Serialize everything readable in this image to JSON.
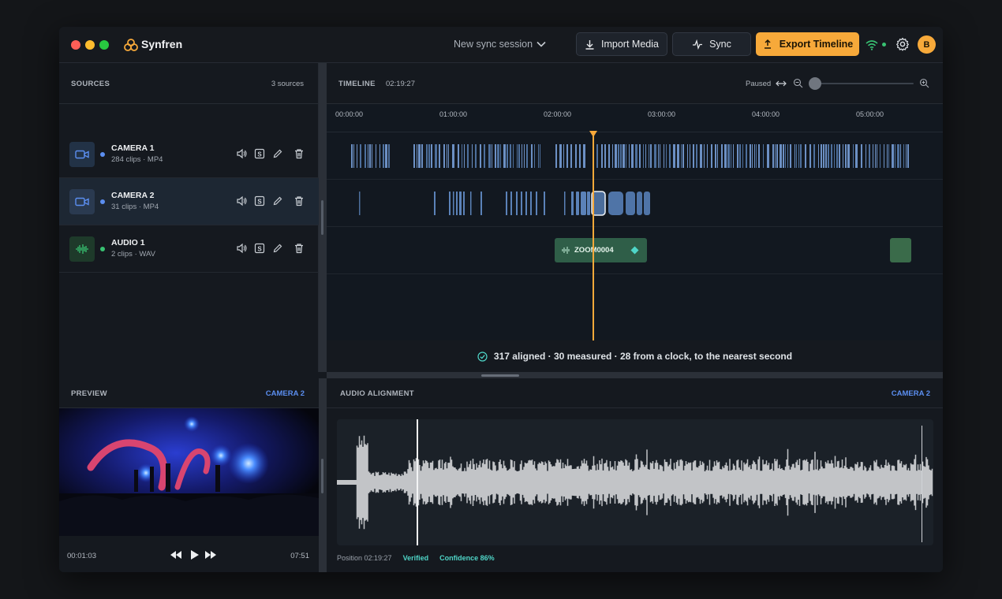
{
  "app": {
    "name": "Synfren",
    "session": "New sync session"
  },
  "toolbar": {
    "import_label": "Import Media",
    "sync_label": "Sync",
    "export_label": "Export Timeline",
    "avatar_initial": "B",
    "accent": "#f7a93a"
  },
  "sources": {
    "title": "SOURCES",
    "count": "3 sources",
    "items": [
      {
        "name": "CAMERA 1",
        "meta": "284 clips · MP4",
        "color": "#5b8ef0",
        "icon": "camera-icon"
      },
      {
        "name": "CAMERA 2",
        "meta": "31 clips · MP4",
        "color": "#5b8ef0",
        "icon": "camera-icon",
        "selected": true
      },
      {
        "name": "AUDIO 1",
        "meta": "2 clips · WAV",
        "color": "#38c172",
        "icon": "waveform-icon"
      }
    ]
  },
  "timeline": {
    "title": "TIMELINE",
    "position": "02:19:27",
    "state": "Paused",
    "ticks": [
      "00:00:00",
      "01:00:00",
      "02:00:00",
      "03:00:00",
      "04:00:00",
      "05:00:00"
    ],
    "zoom_level": 0,
    "audio_clip_label": "ZOOM0004",
    "status": "317 aligned · 30 measured · 28 from a clock, to the nearest second"
  },
  "preview": {
    "title": "PREVIEW",
    "source": "CAMERA 2",
    "current_time": "00:01:03",
    "duration": "07:51"
  },
  "alignment": {
    "title": "AUDIO ALIGNMENT",
    "source": "CAMERA 2",
    "position_label": "Position 02:19:27",
    "verified_label": "Verified",
    "confidence_label": "Confidence 86%"
  }
}
